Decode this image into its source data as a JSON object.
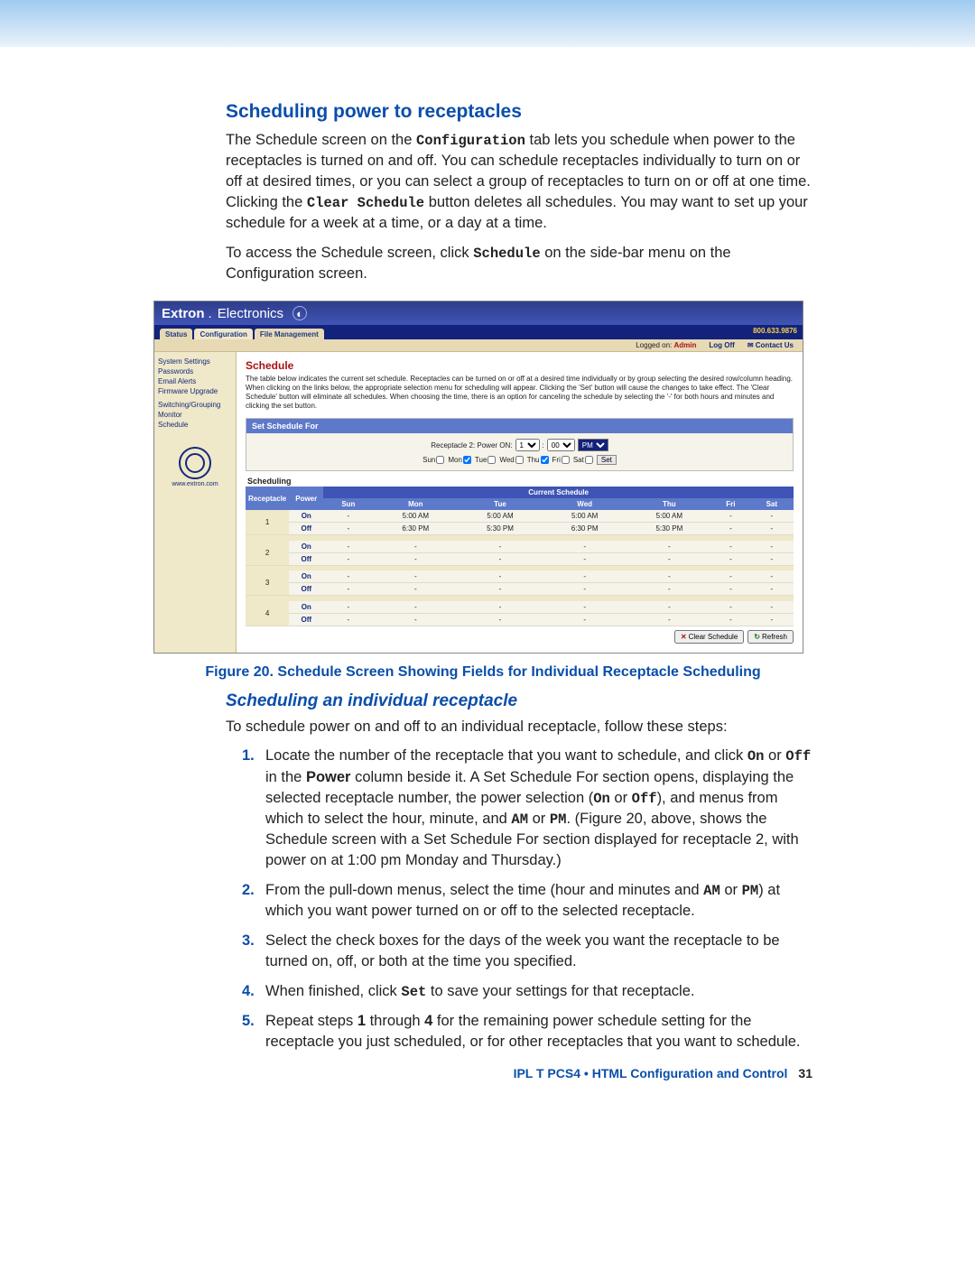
{
  "doc": {
    "heading": "Scheduling power to receptacles",
    "para1_a": "The Schedule screen on the ",
    "para1_cfg": "Configuration",
    "para1_b": " tab lets you schedule when power to the receptacles is turned on and off. You can schedule receptacles individually to turn on or off at desired times, or you can select a group of receptacles to turn on or off at one time. Clicking the ",
    "para1_clear": "Clear Schedule",
    "para1_c": " button deletes all schedules. You may want to set up your schedule for a week at a time, or a day at a time.",
    "para2_a": "To access the Schedule screen, click ",
    "para2_sched": "Schedule",
    "para2_b": " on the side-bar menu on the Configuration screen.",
    "figcap_num": "Figure 20.",
    "figcap_txt": " Schedule Screen Showing Fields for Individual Receptacle Scheduling",
    "subheading": "Scheduling an individual receptacle",
    "para3": "To schedule power on and off to an individual receptacle, follow these steps:",
    "steps": {
      "s1_a": "Locate the number of the receptacle that you want to schedule, and click ",
      "s1_on": "On",
      "s1_or1": " or ",
      "s1_off": "Off",
      "s1_b": " in the ",
      "s1_power": "Power",
      "s1_c": " column beside it. A Set Schedule For section opens, displaying the selected receptacle number, the power selection (",
      "s1_on2": "On",
      "s1_or2": " or ",
      "s1_off2": "Off",
      "s1_d": "), and menus from which to select the hour, minute, and ",
      "s1_am": "AM",
      "s1_or3": " or ",
      "s1_pm": "PM",
      "s1_e": ". (Figure 20, above, shows the Schedule screen with a Set Schedule For section displayed for receptacle 2, with power on at 1:00 pm Monday and Thursday.)",
      "s2_a": "From the pull-down menus, select the time (hour and minutes and ",
      "s2_am": "AM",
      "s2_or": " or ",
      "s2_pm": "PM",
      "s2_b": ") at which you want power turned on or off to the selected receptacle.",
      "s3": "Select the check boxes for the days of the week you want the receptacle to be turned on, off, or both at the time you specified.",
      "s4_a": "When finished, click ",
      "s4_set": "Set",
      "s4_b": " to save your settings for that receptacle.",
      "s5_a": "Repeat steps ",
      "s5_1": "1",
      "s5_thru": " through ",
      "s5_4": "4",
      "s5_b": " for the remaining power schedule setting for the receptacle you just scheduled, or for other receptacles that you want to schedule."
    },
    "footer_prod": "IPL T PCS4 • ",
    "footer_sec": "HTML Configuration and Control",
    "footer_page": "31"
  },
  "app": {
    "brand1": "Extron",
    "brand2": "Electronics",
    "phone": "800.633.9876",
    "tabs": [
      "Status",
      "Configuration",
      "File Management"
    ],
    "login_label": "Logged on:",
    "login_user": "Admin",
    "logoff": "Log Off",
    "contact": "Contact Us",
    "sidebar": {
      "items": [
        "System Settings",
        "Passwords",
        "Email Alerts",
        "Firmware Upgrade",
        "Switching/Grouping",
        "Monitor",
        "Schedule"
      ],
      "url": "www.extron.com"
    },
    "page_title": "Schedule",
    "desc": "The table below indicates the current set schedule. Receptacles can be turned on or off at a desired time individually or by group selecting the desired row/column heading. When clicking on the links below, the appropriate selection menu for scheduling will appear. Clicking the 'Set' button will cause the changes to take effect. The 'Clear Schedule' button will eliminate all schedules. When choosing the time, there is an option for canceling the schedule by selecting the '-' for both hours and minutes and clicking the set button.",
    "set_panel_title": "Set Schedule For",
    "set_row_label": "Receptacle 2: Power ON:",
    "hour_sel": "1",
    "min_sel": "00",
    "ampm_sel": "PM",
    "days": [
      "Sun",
      "Mon",
      "Tue",
      "Wed",
      "Thu",
      "Fri",
      "Sat"
    ],
    "checked_days": [
      "Mon",
      "Thu"
    ],
    "set_btn": "Set",
    "scheduling_label": "Scheduling",
    "col_rec": "Receptacle",
    "col_pow": "Power",
    "col_cur": "Current Schedule",
    "on_label": "On",
    "off_label": "Off",
    "clear_btn": "Clear Schedule",
    "refresh_btn": "Refresh"
  },
  "chart_data": {
    "type": "table",
    "title": "Current Schedule",
    "columns": [
      "Receptacle",
      "Power",
      "Sun",
      "Mon",
      "Tue",
      "Wed",
      "Thu",
      "Fri",
      "Sat"
    ],
    "rows": [
      {
        "receptacle": 1,
        "power": "On",
        "Sun": "-",
        "Mon": "5:00 AM",
        "Tue": "5:00 AM",
        "Wed": "5:00 AM",
        "Thu": "5:00 AM",
        "Fri": "-",
        "Sat": "-"
      },
      {
        "receptacle": 1,
        "power": "Off",
        "Sun": "-",
        "Mon": "6:30 PM",
        "Tue": "5:30 PM",
        "Wed": "6:30 PM",
        "Thu": "5:30 PM",
        "Fri": "-",
        "Sat": "-"
      },
      {
        "receptacle": 2,
        "power": "On",
        "Sun": "-",
        "Mon": "-",
        "Tue": "-",
        "Wed": "-",
        "Thu": "-",
        "Fri": "-",
        "Sat": "-"
      },
      {
        "receptacle": 2,
        "power": "Off",
        "Sun": "-",
        "Mon": "-",
        "Tue": "-",
        "Wed": "-",
        "Thu": "-",
        "Fri": "-",
        "Sat": "-"
      },
      {
        "receptacle": 3,
        "power": "On",
        "Sun": "-",
        "Mon": "-",
        "Tue": "-",
        "Wed": "-",
        "Thu": "-",
        "Fri": "-",
        "Sat": "-"
      },
      {
        "receptacle": 3,
        "power": "Off",
        "Sun": "-",
        "Mon": "-",
        "Tue": "-",
        "Wed": "-",
        "Thu": "-",
        "Fri": "-",
        "Sat": "-"
      },
      {
        "receptacle": 4,
        "power": "On",
        "Sun": "-",
        "Mon": "-",
        "Tue": "-",
        "Wed": "-",
        "Thu": "-",
        "Fri": "-",
        "Sat": "-"
      },
      {
        "receptacle": 4,
        "power": "Off",
        "Sun": "-",
        "Mon": "-",
        "Tue": "-",
        "Wed": "-",
        "Thu": "-",
        "Fri": "-",
        "Sat": "-"
      }
    ]
  }
}
